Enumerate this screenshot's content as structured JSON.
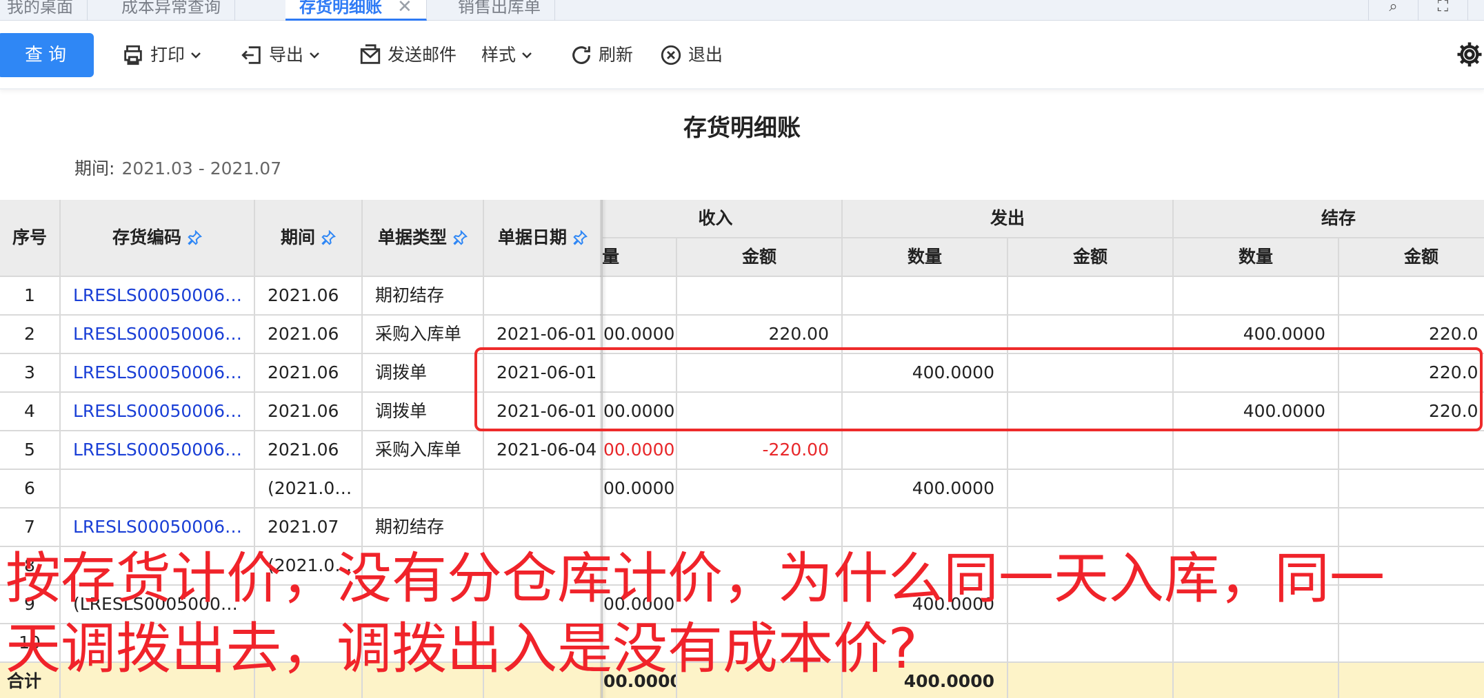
{
  "tabs": [
    {
      "label": "我的桌面"
    },
    {
      "label": "成本异常查询"
    },
    {
      "label": "存货明细账"
    },
    {
      "label": "销售出库单"
    }
  ],
  "toolbar": {
    "query": "查询",
    "print": "打印",
    "export": "导出",
    "email": "发送邮件",
    "style": "样式",
    "refresh": "刷新",
    "exit": "退出"
  },
  "report": {
    "title": "存货明细账",
    "period_label": "期间:",
    "period_value": "2021.03 - 2021.07"
  },
  "table": {
    "headers": {
      "seq": "序号",
      "code": "存货编码",
      "period": "期间",
      "doc_type": "单据类型",
      "doc_date": "单据日期",
      "income": "收入",
      "issue": "发出",
      "balance": "结存",
      "qty_partial": "量",
      "qty": "数量",
      "amount": "金额"
    },
    "rows": [
      {
        "seq": "1",
        "code": "LRESLS00050006…",
        "period": "2021.06",
        "doc_type": "期初结存",
        "doc_date": "",
        "in_qty": "",
        "in_amt": "",
        "out_qty": "",
        "out_amt": "",
        "bal_qty": "",
        "bal_amt": ""
      },
      {
        "seq": "2",
        "code": "LRESLS00050006…",
        "period": "2021.06",
        "doc_type": "采购入库单",
        "doc_date": "2021-06-01",
        "in_qty": "00.0000",
        "in_amt": "220.00",
        "out_qty": "",
        "out_amt": "",
        "bal_qty": "400.0000",
        "bal_amt": "220.0"
      },
      {
        "seq": "3",
        "code": "LRESLS00050006…",
        "period": "2021.06",
        "doc_type": "调拨单",
        "doc_date": "2021-06-01",
        "in_qty": "",
        "in_amt": "",
        "out_qty": "400.0000",
        "out_amt": "",
        "bal_qty": "",
        "bal_amt": "220.0"
      },
      {
        "seq": "4",
        "code": "LRESLS00050006…",
        "period": "2021.06",
        "doc_type": "调拨单",
        "doc_date": "2021-06-01",
        "in_qty": "00.0000",
        "in_amt": "",
        "out_qty": "",
        "out_amt": "",
        "bal_qty": "400.0000",
        "bal_amt": "220.0"
      },
      {
        "seq": "5",
        "code": "LRESLS00050006…",
        "period": "2021.06",
        "doc_type": "采购入库单",
        "doc_date": "2021-06-04",
        "in_qty": "00.0000",
        "in_amt": "-220.00",
        "out_qty": "",
        "out_amt": "",
        "bal_qty": "",
        "bal_amt": ""
      },
      {
        "seq": "6",
        "code": "",
        "period": "(2021.0…",
        "doc_type": "",
        "doc_date": "",
        "in_qty": "00.0000",
        "in_amt": "",
        "out_qty": "400.0000",
        "out_amt": "",
        "bal_qty": "",
        "bal_amt": ""
      },
      {
        "seq": "7",
        "code": "LRESLS00050006…",
        "period": "2021.07",
        "doc_type": "期初结存",
        "doc_date": "",
        "in_qty": "",
        "in_amt": "",
        "out_qty": "",
        "out_amt": "",
        "bal_qty": "",
        "bal_amt": ""
      },
      {
        "seq": "8",
        "code": "",
        "period": "(2021.0…",
        "doc_type": "",
        "doc_date": "",
        "in_qty": "",
        "in_amt": "",
        "out_qty": "",
        "out_amt": "",
        "bal_qty": "",
        "bal_amt": ""
      },
      {
        "seq": "9",
        "code": "(LRESLS0005000…",
        "period": "",
        "doc_type": "",
        "doc_date": "",
        "in_qty": "00.0000",
        "in_amt": "",
        "out_qty": "400.0000",
        "out_amt": "",
        "bal_qty": "",
        "bal_amt": ""
      },
      {
        "seq": "10",
        "code": "",
        "period": "",
        "doc_type": "",
        "doc_date": "",
        "in_qty": "",
        "in_amt": "",
        "out_qty": "",
        "out_amt": "",
        "bal_qty": "",
        "bal_amt": ""
      }
    ],
    "total": {
      "label": "合计",
      "in_qty": "00.0000",
      "out_qty": "400.0000"
    }
  },
  "overlay": {
    "line1": "按存货计价，没有分仓库计价，为什么同一天入库，同一",
    "line2": "天调拨出去，调拨出入是没有成本价?"
  },
  "colors": {
    "accent": "#2f87f5",
    "link": "#1a3fd6",
    "negative": "#e8272a",
    "annotation": "#f0232a",
    "total_row": "#fdf3c8"
  }
}
